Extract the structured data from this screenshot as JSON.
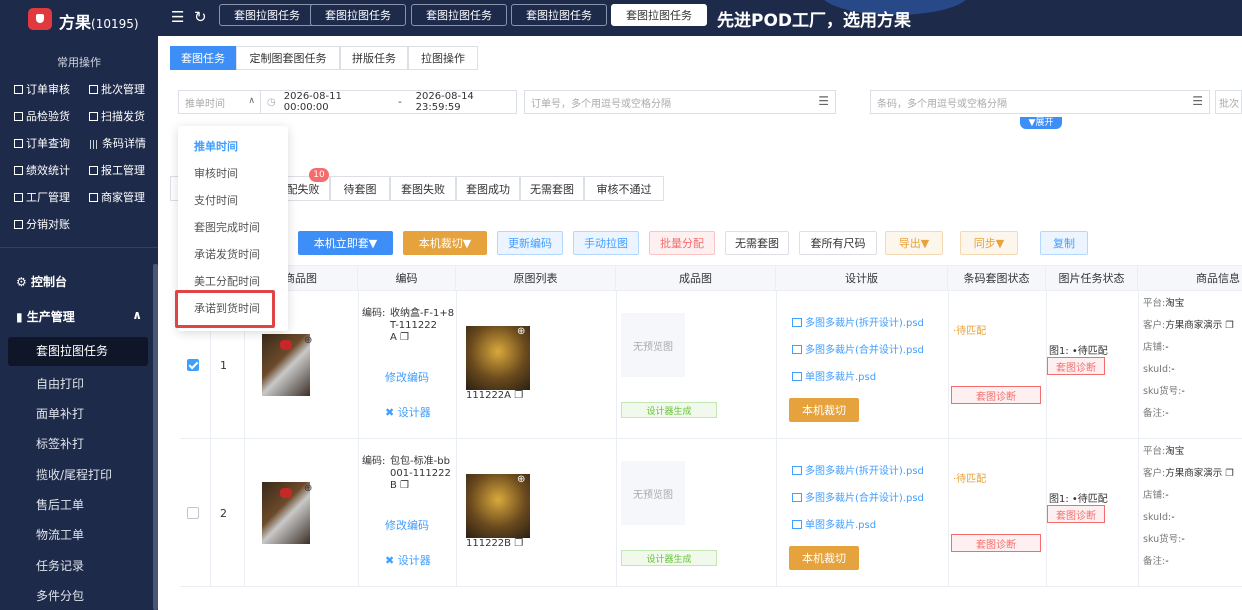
{
  "app": {
    "name": "方果",
    "count": "(10195)"
  },
  "top_tabs": [
    "套图拉图任务",
    "套图拉图任务",
    "套图拉图任务",
    "套图拉图任务",
    "套图拉图任务"
  ],
  "slogan": "先进POD工厂，选用方果",
  "sidebar": {
    "quick_title": "常用操作",
    "quick_items": [
      {
        "label": "订单审核",
        "icon": "checkbox-icon"
      },
      {
        "label": "批次管理",
        "icon": "checkbox-icon"
      },
      {
        "label": "品检验货",
        "icon": "checkbox-icon"
      },
      {
        "label": "扫描发货",
        "icon": "checkbox-icon"
      },
      {
        "label": "订单查询",
        "icon": "checkbox-icon"
      },
      {
        "label": "条码详情",
        "icon": "barcode-icon"
      },
      {
        "label": "绩效统计",
        "icon": "checkbox-icon"
      },
      {
        "label": "报工管理",
        "icon": "checkbox-icon"
      },
      {
        "label": "工厂管理",
        "icon": "checkbox-icon"
      },
      {
        "label": "商家管理",
        "icon": "checkbox-icon"
      },
      {
        "label": "分销对账",
        "icon": "checkbox-icon"
      }
    ],
    "menu_console": "控制台",
    "menu_production": "生产管理",
    "menu_items": [
      "套图拉图任务",
      "自由打印",
      "面单补打",
      "标签补打",
      "揽收/尾程打印",
      "售后工单",
      "物流工单",
      "任务记录",
      "多件分包"
    ]
  },
  "sub_tabs": [
    "套图任务",
    "定制图套图任务",
    "拼版任务",
    "拉图操作"
  ],
  "filters": {
    "time_select_placeholder": "推单时间",
    "date_start": "2026-08-11 00:00:00",
    "date_sep": "-",
    "date_end": "2026-08-14 23:59:59",
    "order_placeholder": "订单号，多个用逗号或空格分隔",
    "barcode_placeholder": "条码，多个用逗号或空格分隔",
    "batch_placeholder": "批次",
    "expand_label": "▼展开"
  },
  "status_tabs": [
    "配失败",
    "待套图",
    "套图失败",
    "套图成功",
    "无需套图",
    "审核不通过"
  ],
  "status_badge": "10",
  "actions": [
    "本机立即套▼",
    "本机裁切▼",
    "更新编码",
    "手动拉图",
    "批量分配",
    "无需套图",
    "套所有尺码",
    "导出▼",
    "同步▼",
    "复制"
  ],
  "table": {
    "headers": [
      "商品图",
      "编码",
      "原图列表",
      "成品图",
      "设计版",
      "条码套图状态",
      "图片任务状态",
      "商品信息"
    ],
    "rows": [
      {
        "index": "1",
        "code_key": "编码:",
        "code_val": "收纳盒-F-1+8T-111222A",
        "code_lines": [
          "收纳盒-F-1+8",
          "T-111222",
          "A ❐"
        ],
        "edit": "修改编码",
        "designer": "设计器",
        "orig_code": "111222A ❐",
        "no_preview": "无预览图",
        "gen": "设计器生成",
        "psd": [
          "多图多裁片(拆开设计).psd",
          "多图多裁片(合并设计).psd",
          "单图多裁片.psd"
        ],
        "cut": "本机裁切",
        "barcode_status": "·待匹配",
        "diag": "套图诊断",
        "pic_status": "图1: •待匹配",
        "info": [
          [
            "平台:",
            "淘宝"
          ],
          [
            "客户:",
            "方果商家演示 ❐"
          ],
          [
            "店铺:",
            "-"
          ],
          [
            "skuId:",
            "-"
          ],
          [
            "sku货号:",
            "-"
          ],
          [
            "备注:",
            "-"
          ]
        ],
        "checked": true
      },
      {
        "index": "2",
        "code_key": "编码:",
        "code_val": "包包-标准-bb001-111222B",
        "code_lines": [
          "包包-标准-bb",
          "001-111222",
          "B ❐"
        ],
        "edit": "修改编码",
        "designer": "设计器",
        "orig_code": "111222B ❐",
        "no_preview": "无预览图",
        "gen": "设计器生成",
        "psd": [
          "多图多裁片(拆开设计).psd",
          "多图多裁片(合并设计).psd",
          "单图多裁片.psd"
        ],
        "cut": "本机裁切",
        "barcode_status": "·待匹配",
        "diag": "套图诊断",
        "pic_status": "图1: •待匹配",
        "info": [
          [
            "平台:",
            "淘宝"
          ],
          [
            "客户:",
            "方果商家演示 ❐"
          ],
          [
            "店铺:",
            "-"
          ],
          [
            "skuId:",
            "-"
          ],
          [
            "sku货号:",
            "-"
          ],
          [
            "备注:",
            "-"
          ]
        ],
        "checked": false
      }
    ]
  },
  "dropdown": [
    "推单时间",
    "审核时间",
    "支付时间",
    "套图完成时间",
    "承诺发货时间",
    "美工分配时间",
    "承诺到货时间"
  ],
  "colors": {
    "primary": "#3e8ef7",
    "sidebar": "#1e2a4a",
    "orange": "#e6a23c",
    "danger": "#f56c6c",
    "highlight": "#e04444"
  }
}
